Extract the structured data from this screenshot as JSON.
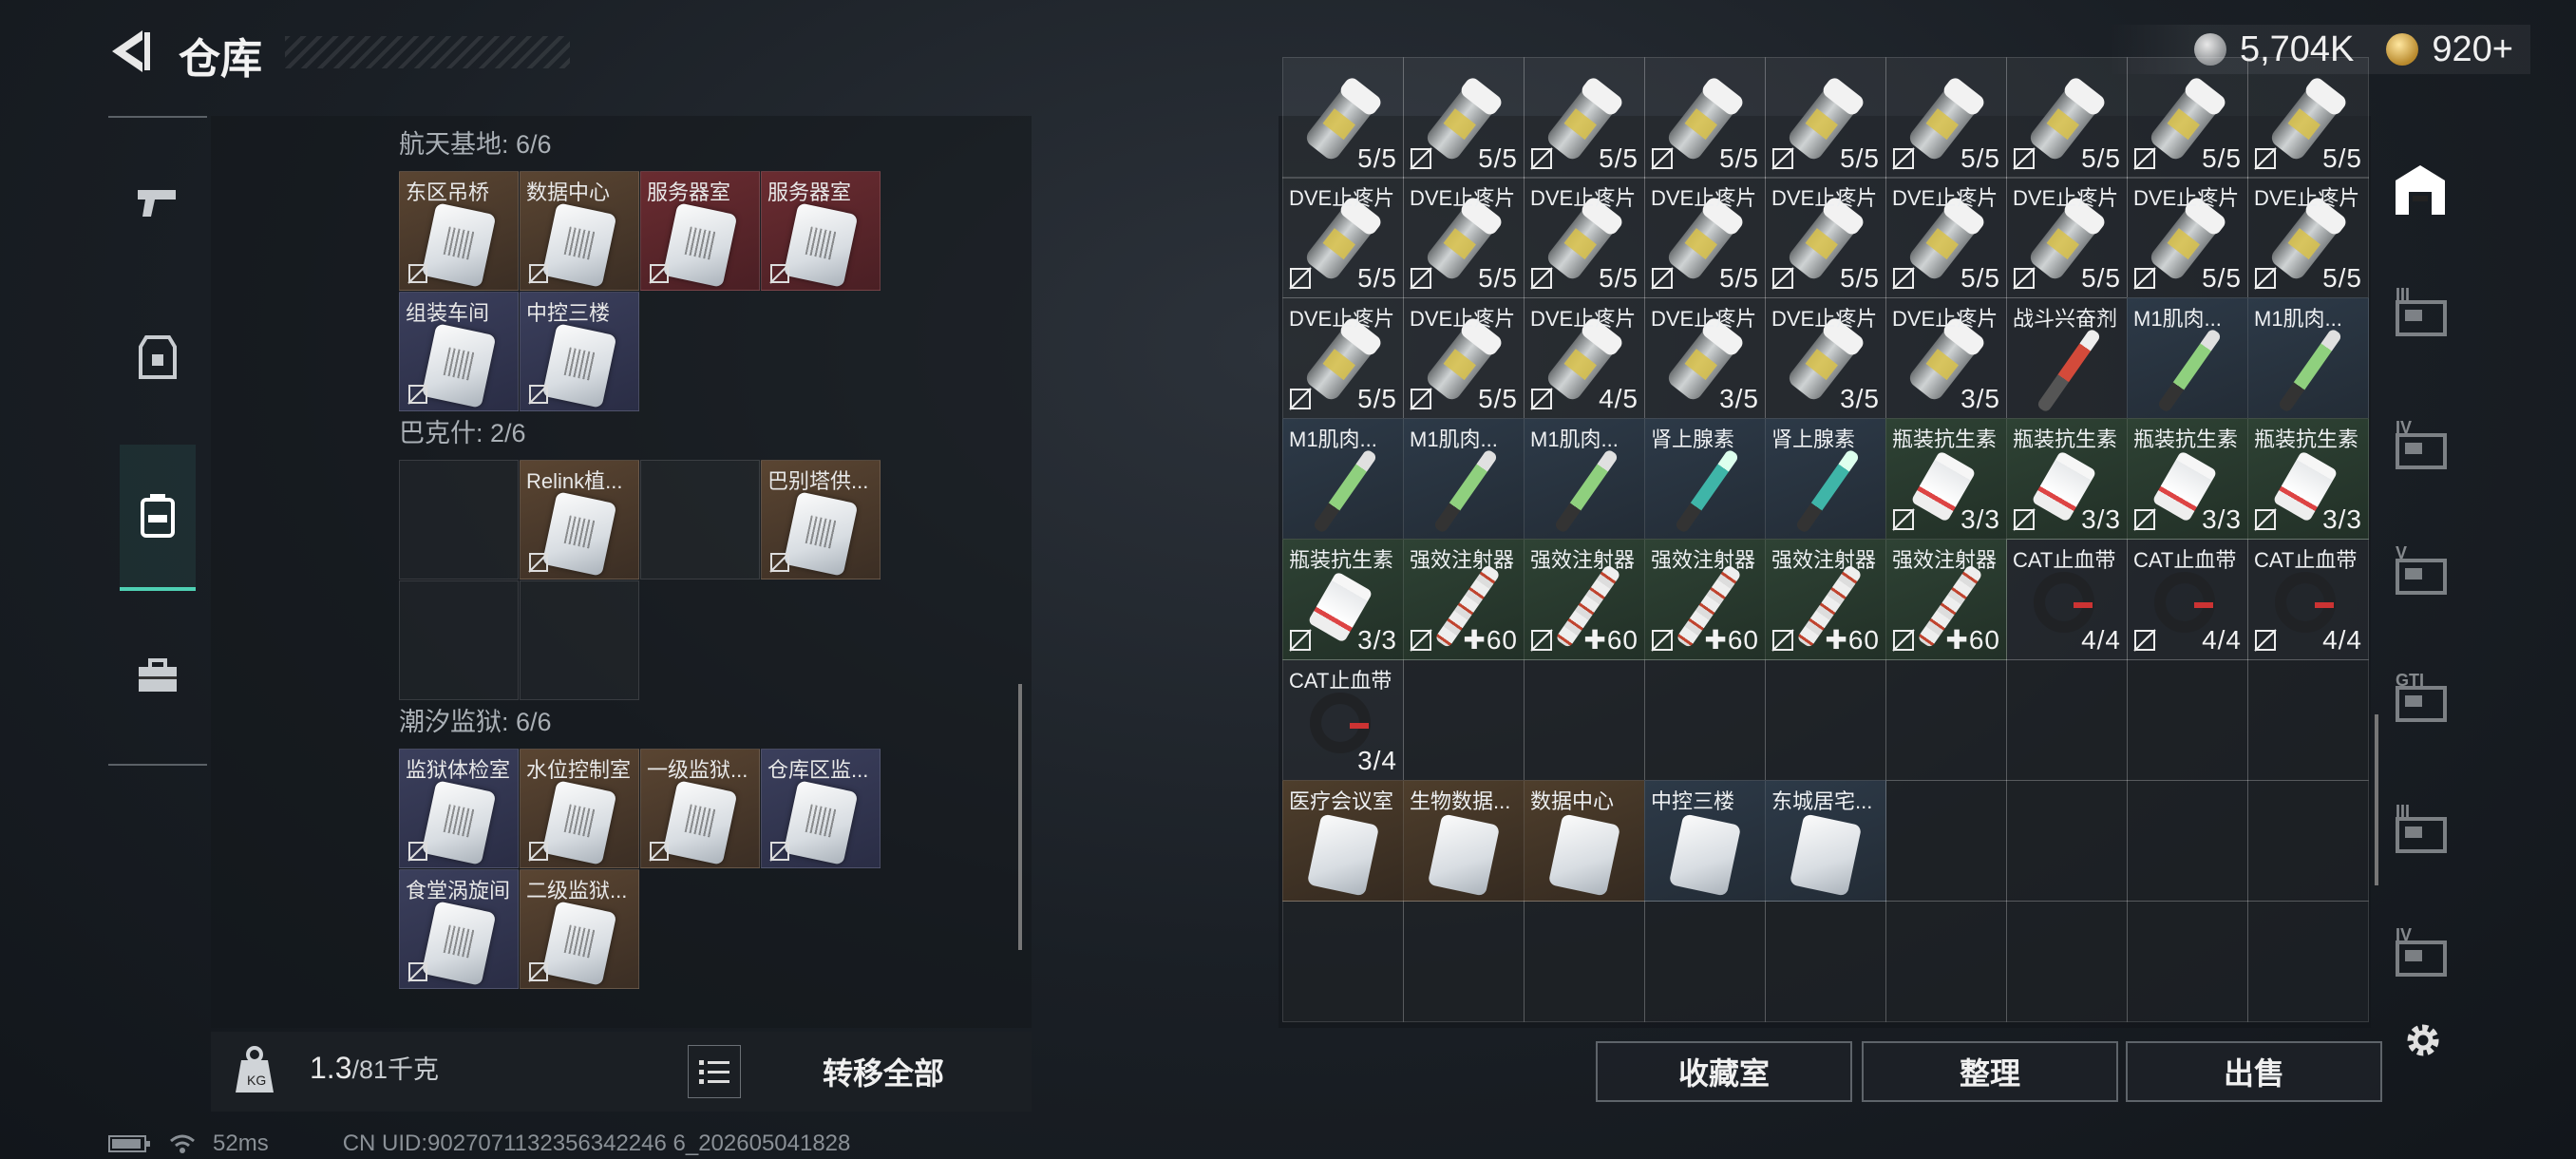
{
  "header": {
    "title": "仓库",
    "currency1": "5,704K",
    "currency2": "920+"
  },
  "left": {
    "sections": [
      {
        "title": "航天基地: 6/6",
        "cards": [
          {
            "label": "东区吊桥",
            "bg": "brown"
          },
          {
            "label": "数据中心",
            "bg": "brown"
          },
          {
            "label": "服务器室",
            "bg": "red"
          },
          {
            "label": "服务器室",
            "bg": "red"
          },
          {
            "label": "组装车间",
            "bg": "blue"
          },
          {
            "label": "中控三楼",
            "bg": "blue"
          }
        ]
      },
      {
        "title": "巴克什: 2/6",
        "cards": [
          {
            "label": "",
            "bg": "empty"
          },
          {
            "label": "Relink植...",
            "bg": "brown"
          },
          {
            "label": "",
            "bg": "empty"
          },
          {
            "label": "巴别塔供...",
            "bg": "brown"
          },
          {
            "label": "",
            "bg": "empty"
          },
          {
            "label": "",
            "bg": "empty"
          }
        ]
      },
      {
        "title": "潮汐监狱: 6/6",
        "cards": [
          {
            "label": "监狱体检室",
            "bg": "blue"
          },
          {
            "label": "水位控制室",
            "bg": "brown"
          },
          {
            "label": "一级监狱...",
            "bg": "brown"
          },
          {
            "label": "仓库区监...",
            "bg": "blue"
          },
          {
            "label": "食堂涡旋间",
            "bg": "blue"
          },
          {
            "label": "二级监狱...",
            "bg": "brown"
          }
        ]
      }
    ],
    "weight_value": "1.3",
    "weight_total": "/81千克",
    "move_all": "转移全部"
  },
  "status": {
    "ping": "52ms",
    "uid": "CN UID:9027071132356342246 6_202605041828"
  },
  "grid": {
    "rows": [
      [
        {
          "l": "",
          "c": "5/5",
          "t": "pill",
          "g": "g-gray"
        },
        {
          "l": "",
          "c": "5/5",
          "t": "pill",
          "g": "g-gray",
          "nd": 1
        },
        {
          "l": "",
          "c": "5/5",
          "t": "pill",
          "g": "g-gray",
          "nd": 1
        },
        {
          "l": "",
          "c": "5/5",
          "t": "pill",
          "g": "g-gray",
          "nd": 1
        },
        {
          "l": "",
          "c": "5/5",
          "t": "pill",
          "g": "g-gray",
          "nd": 1
        },
        {
          "l": "",
          "c": "5/5",
          "t": "pill",
          "g": "g-gray",
          "nd": 1
        },
        {
          "l": "",
          "c": "5/5",
          "t": "pill",
          "g": "g-gray",
          "nd": 1
        },
        {
          "l": "",
          "c": "5/5",
          "t": "pill",
          "g": "g-gray",
          "nd": 1
        },
        {
          "l": "",
          "c": "5/5",
          "t": "pill",
          "g": "g-gray",
          "nd": 1
        }
      ],
      [
        {
          "l": "DVE止疼片",
          "c": "5/5",
          "t": "pill",
          "g": "g-gray",
          "nd": 1
        },
        {
          "l": "DVE止疼片",
          "c": "5/5",
          "t": "pill",
          "g": "g-gray",
          "nd": 1
        },
        {
          "l": "DVE止疼片",
          "c": "5/5",
          "t": "pill",
          "g": "g-gray",
          "nd": 1
        },
        {
          "l": "DVE止疼片",
          "c": "5/5",
          "t": "pill",
          "g": "g-gray",
          "nd": 1
        },
        {
          "l": "DVE止疼片",
          "c": "5/5",
          "t": "pill",
          "g": "g-gray",
          "nd": 1
        },
        {
          "l": "DVE止疼片",
          "c": "5/5",
          "t": "pill",
          "g": "g-gray",
          "nd": 1
        },
        {
          "l": "DVE止疼片",
          "c": "5/5",
          "t": "pill",
          "g": "g-gray",
          "nd": 1
        },
        {
          "l": "DVE止疼片",
          "c": "5/5",
          "t": "pill",
          "g": "g-gray",
          "nd": 1
        },
        {
          "l": "DVE止疼片",
          "c": "5/5",
          "t": "pill",
          "g": "g-gray",
          "nd": 1
        }
      ],
      [
        {
          "l": "DVE止疼片",
          "c": "5/5",
          "t": "pill",
          "g": "g-gray",
          "nd": 1
        },
        {
          "l": "DVE止疼片",
          "c": "5/5",
          "t": "pill",
          "g": "g-gray",
          "nd": 1
        },
        {
          "l": "DVE止疼片",
          "c": "4/5",
          "t": "pill",
          "g": "g-gray",
          "nd": 1
        },
        {
          "l": "DVE止疼片",
          "c": "3/5",
          "t": "pill",
          "g": "g-gray"
        },
        {
          "l": "DVE止疼片",
          "c": "3/5",
          "t": "pill",
          "g": "g-gray"
        },
        {
          "l": "DVE止疼片",
          "c": "3/5",
          "t": "pill",
          "g": "g-gray"
        },
        {
          "l": "战斗兴奋剂",
          "c": "",
          "t": "injector red",
          "g": "g-gray"
        },
        {
          "l": "M1肌肉...",
          "c": "",
          "t": "injector",
          "g": "g-blue"
        },
        {
          "l": "M1肌肉...",
          "c": "",
          "t": "injector",
          "g": "g-blue"
        }
      ],
      [
        {
          "l": "M1肌肉...",
          "c": "",
          "t": "injector",
          "g": "g-blue"
        },
        {
          "l": "M1肌肉...",
          "c": "",
          "t": "injector",
          "g": "g-blue"
        },
        {
          "l": "M1肌肉...",
          "c": "",
          "t": "injector",
          "g": "g-blue"
        },
        {
          "l": "肾上腺素",
          "c": "",
          "t": "injector teal",
          "g": "g-blue"
        },
        {
          "l": "肾上腺素",
          "c": "",
          "t": "injector teal",
          "g": "g-blue"
        },
        {
          "l": "瓶装抗生素",
          "c": "3/3",
          "t": "bottle",
          "g": "g-green",
          "nd": 1
        },
        {
          "l": "瓶装抗生素",
          "c": "3/3",
          "t": "bottle",
          "g": "g-green",
          "nd": 1
        },
        {
          "l": "瓶装抗生素",
          "c": "3/3",
          "t": "bottle",
          "g": "g-green",
          "nd": 1
        },
        {
          "l": "瓶装抗生素",
          "c": "3/3",
          "t": "bottle",
          "g": "g-green",
          "nd": 1
        }
      ],
      [
        {
          "l": "瓶装抗生素",
          "c": "3/3",
          "t": "bottle",
          "g": "g-green",
          "nd": 1
        },
        {
          "l": "强效注射器",
          "c": "✚60",
          "t": "syringe",
          "g": "g-green",
          "nd": 1
        },
        {
          "l": "强效注射器",
          "c": "✚60",
          "t": "syringe",
          "g": "g-green",
          "nd": 1
        },
        {
          "l": "强效注射器",
          "c": "✚60",
          "t": "syringe",
          "g": "g-green",
          "nd": 1
        },
        {
          "l": "强效注射器",
          "c": "✚60",
          "t": "syringe",
          "g": "g-green",
          "nd": 1
        },
        {
          "l": "强效注射器",
          "c": "✚60",
          "t": "syringe",
          "g": "g-green",
          "nd": 1
        },
        {
          "l": "CAT止血带",
          "c": "4/4",
          "t": "tq",
          "g": "g-gray"
        },
        {
          "l": "CAT止血带",
          "c": "4/4",
          "t": "tq",
          "g": "g-gray",
          "nd": 1
        },
        {
          "l": "CAT止血带",
          "c": "4/4",
          "t": "tq",
          "g": "g-gray",
          "nd": 1
        }
      ],
      [
        {
          "l": "CAT止血带",
          "c": "3/4",
          "t": "tq",
          "g": "g-gray"
        },
        {
          "l": "",
          "c": "",
          "t": "",
          "g": "g-empty"
        },
        {
          "l": "",
          "c": "",
          "t": "",
          "g": "g-empty"
        },
        {
          "l": "",
          "c": "",
          "t": "",
          "g": "g-empty"
        },
        {
          "l": "",
          "c": "",
          "t": "",
          "g": "g-empty"
        },
        {
          "l": "",
          "c": "",
          "t": "",
          "g": "g-empty"
        },
        {
          "l": "",
          "c": "",
          "t": "",
          "g": "g-empty"
        },
        {
          "l": "",
          "c": "",
          "t": "",
          "g": "g-empty"
        },
        {
          "l": "",
          "c": "",
          "t": "",
          "g": "g-empty"
        }
      ],
      [
        {
          "l": "医疗会议室",
          "c": "",
          "t": "key",
          "g": "g-brown"
        },
        {
          "l": "生物数据...",
          "c": "",
          "t": "key",
          "g": "g-brown"
        },
        {
          "l": "数据中心",
          "c": "",
          "t": "key",
          "g": "g-brown"
        },
        {
          "l": "中控三楼",
          "c": "",
          "t": "key",
          "g": "g-blue"
        },
        {
          "l": "东城居宅...",
          "c": "",
          "t": "key",
          "g": "g-blue"
        },
        {
          "l": "",
          "c": "",
          "t": "",
          "g": "g-empty"
        },
        {
          "l": "",
          "c": "",
          "t": "",
          "g": "g-empty"
        },
        {
          "l": "",
          "c": "",
          "t": "",
          "g": "g-empty"
        },
        {
          "l": "",
          "c": "",
          "t": "",
          "g": "g-empty"
        }
      ],
      [
        {
          "l": "",
          "c": "",
          "t": "",
          "g": "g-empty"
        },
        {
          "l": "",
          "c": "",
          "t": "",
          "g": "g-empty"
        },
        {
          "l": "",
          "c": "",
          "t": "",
          "g": "g-empty"
        },
        {
          "l": "",
          "c": "",
          "t": "",
          "g": "g-empty"
        },
        {
          "l": "",
          "c": "",
          "t": "",
          "g": "g-empty"
        },
        {
          "l": "",
          "c": "",
          "t": "",
          "g": "g-empty"
        },
        {
          "l": "",
          "c": "",
          "t": "",
          "g": "g-empty"
        },
        {
          "l": "",
          "c": "",
          "t": "",
          "g": "g-empty"
        },
        {
          "l": "",
          "c": "",
          "t": "",
          "g": "g-empty"
        }
      ]
    ]
  },
  "buttons": {
    "collection": "收藏室",
    "sort": "整理",
    "sell": "出售"
  },
  "right_nav": {
    "items": [
      "III",
      "IV",
      "V",
      "GTI",
      "III",
      "IV"
    ]
  },
  "icons": {
    "back": "back-arrow-icon",
    "settings": "gear-icon",
    "bag": "backpack-icon",
    "list": "list-icon"
  }
}
